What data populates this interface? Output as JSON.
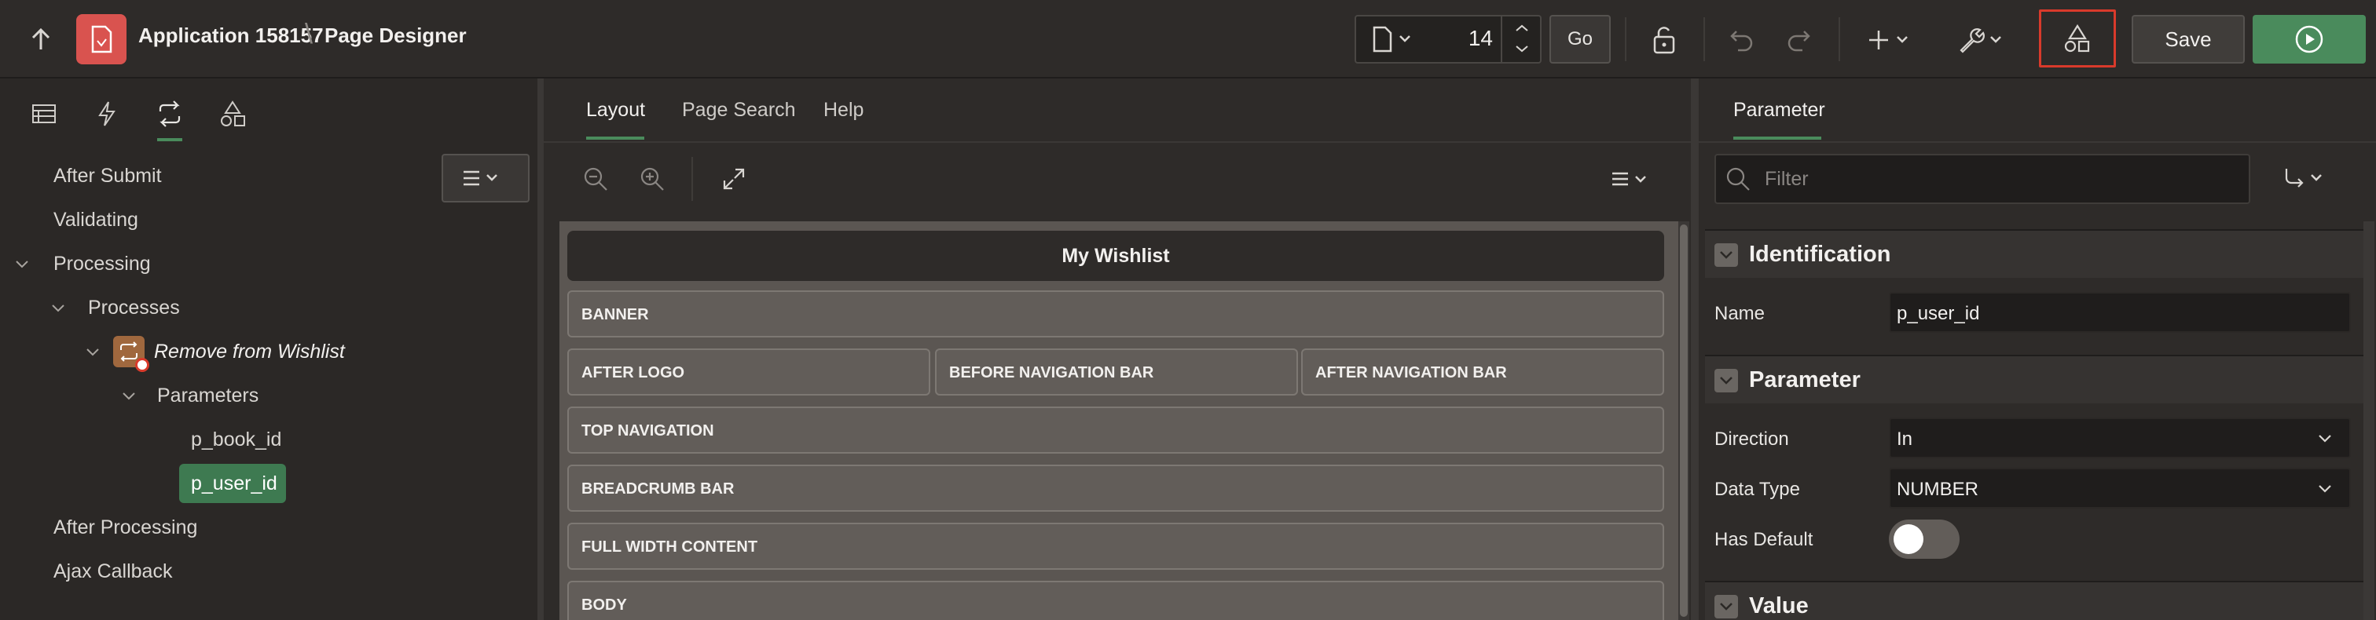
{
  "header": {
    "app_title": "Application 158157",
    "separator": "\\",
    "page_title": "Page Designer",
    "page_number": "14",
    "go_label": "Go",
    "save_label": "Save"
  },
  "left": {
    "tree": {
      "after_submit": "After Submit",
      "validating": "Validating",
      "processing": "Processing",
      "processes": "Processes",
      "process_name": "Remove from Wishlist",
      "parameters": "Parameters",
      "param_1": "p_book_id",
      "param_2": "p_user_id",
      "after_processing": "After Processing",
      "ajax_callback": "Ajax Callback"
    }
  },
  "center": {
    "tabs": [
      "Layout",
      "Page Search",
      "Help"
    ],
    "page_heading": "My Wishlist",
    "regions": {
      "banner": "BANNER",
      "after_logo": "AFTER LOGO",
      "before_nav": "BEFORE NAVIGATION BAR",
      "after_nav": "AFTER NAVIGATION BAR",
      "top_nav": "TOP NAVIGATION",
      "breadcrumb": "BREADCRUMB BAR",
      "full_width": "FULL WIDTH CONTENT",
      "body": "BODY"
    }
  },
  "right": {
    "tab": "Parameter",
    "filter_placeholder": "Filter",
    "sections": {
      "identification": "Identification",
      "parameter": "Parameter",
      "value": "Value"
    },
    "props": {
      "name_label": "Name",
      "name_value": "p_user_id",
      "direction_label": "Direction",
      "direction_value": "In",
      "datatype_label": "Data Type",
      "datatype_value": "NUMBER",
      "hasdefault_label": "Has Default"
    }
  },
  "colors": {
    "accent_green": "#4a8b5c",
    "highlight_red": "#d93a2b",
    "app_icon_red": "#d9534f"
  }
}
